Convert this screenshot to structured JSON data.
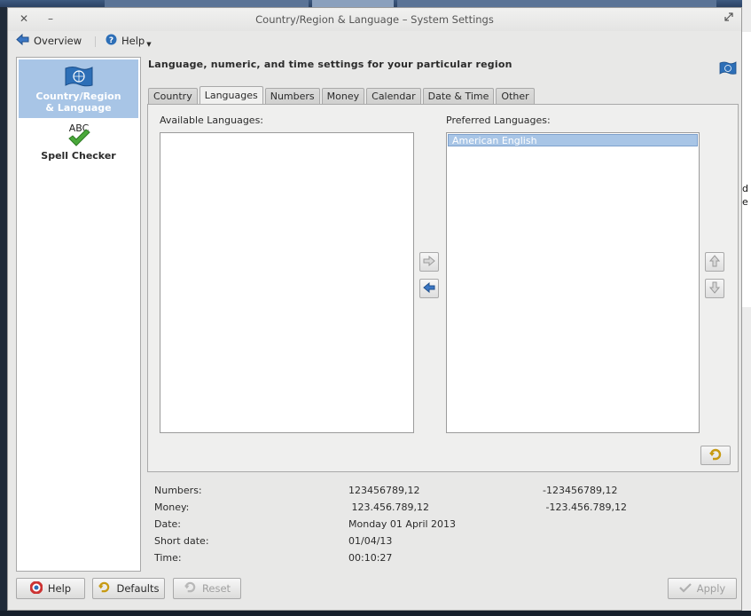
{
  "window": {
    "title": "Country/Region & Language – System Settings"
  },
  "toolbar": {
    "overview_label": "Overview",
    "help_label": "Help"
  },
  "sidebar": {
    "items": [
      {
        "label": "Country/Region & Language",
        "icon": "un-flag-icon",
        "selected": true
      },
      {
        "label": "Spell Checker",
        "icon": "spellcheck-icon",
        "selected": false
      }
    ]
  },
  "header": {
    "description": "Language, numeric, and time settings for your particular region"
  },
  "tabs": [
    {
      "label": "Country"
    },
    {
      "label": "Languages",
      "active": true
    },
    {
      "label": "Numbers"
    },
    {
      "label": "Money"
    },
    {
      "label": "Calendar"
    },
    {
      "label": "Date & Time"
    },
    {
      "label": "Other"
    }
  ],
  "languages": {
    "available_label": "Available Languages:",
    "preferred_label": "Preferred Languages:",
    "available": [],
    "preferred": [
      "American English"
    ]
  },
  "preview": {
    "rows": [
      {
        "label": "Numbers:",
        "value": "123456789,12",
        "negative": "-123456789,12"
      },
      {
        "label": "Money:",
        "value": " 123.456.789,12",
        "negative": " -123.456.789,12"
      },
      {
        "label": "Date:",
        "value": "Monday 01 April 2013",
        "negative": ""
      },
      {
        "label": "Short date:",
        "value": "01/04/13",
        "negative": ""
      },
      {
        "label": "Time:",
        "value": "00:10:27",
        "negative": ""
      }
    ]
  },
  "buttons": {
    "help": "Help",
    "defaults": "Defaults",
    "reset": "Reset",
    "apply": "Apply"
  },
  "desktop": {
    "right_fragments": [
      "d",
      "e"
    ]
  },
  "colors": {
    "selection": "#a8c5e6",
    "accent_blue": "#2d6fb7",
    "check_green": "#4aa83a"
  }
}
